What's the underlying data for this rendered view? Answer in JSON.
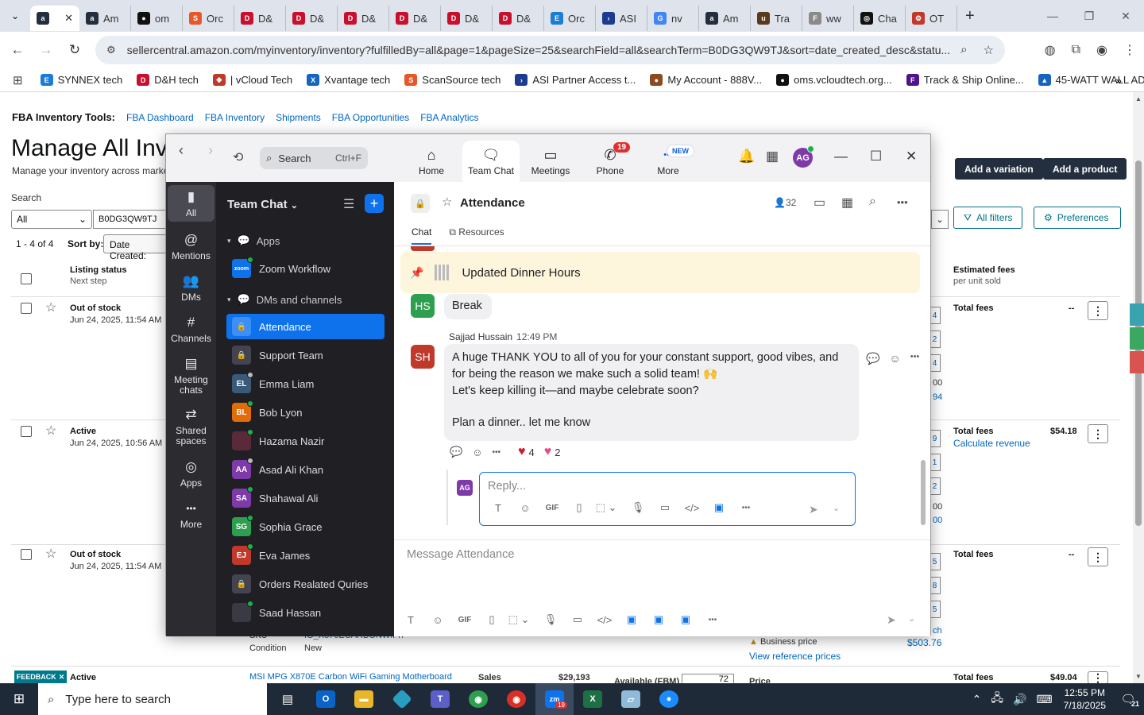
{
  "browser": {
    "tabs": [
      {
        "label": "",
        "favicon": "a",
        "color": "#232f3e",
        "active": true
      },
      {
        "label": "Am",
        "favicon": "a",
        "color": "#232f3e"
      },
      {
        "label": "om",
        "favicon": "●",
        "color": "#111111"
      },
      {
        "label": "Orc",
        "favicon": "S",
        "color": "#e8572a"
      },
      {
        "label": "D&",
        "favicon": "D",
        "color": "#c8102e"
      },
      {
        "label": "D&",
        "favicon": "D",
        "color": "#c8102e"
      },
      {
        "label": "D&",
        "favicon": "D",
        "color": "#c8102e"
      },
      {
        "label": "D&",
        "favicon": "D",
        "color": "#c8102e"
      },
      {
        "label": "D&",
        "favicon": "D",
        "color": "#c8102e"
      },
      {
        "label": "D&",
        "favicon": "D",
        "color": "#c8102e"
      },
      {
        "label": "Orc",
        "favicon": "E",
        "color": "#1a7dd6"
      },
      {
        "label": "ASI",
        "favicon": "›",
        "color": "#1d3c8f"
      },
      {
        "label": "nv",
        "favicon": "G",
        "color": "#4285f4"
      },
      {
        "label": "Am",
        "favicon": "a",
        "color": "#232f3e"
      },
      {
        "label": "Tra",
        "favicon": "u",
        "color": "#5a3a1e"
      },
      {
        "label": "ww",
        "favicon": "F",
        "color": "#8a8a8a"
      },
      {
        "label": "Cha",
        "favicon": "◎",
        "color": "#111111"
      },
      {
        "label": "OT",
        "favicon": "⚙",
        "color": "#c0392b"
      }
    ],
    "url": "sellercentral.amazon.com/myinventory/inventory?fulfilledBy=all&page=1&pageSize=25&searchField=all&searchTerm=B0DG3QW9TJ&sort=date_created_desc&statu...",
    "bookmarks": [
      {
        "label": "SYNNEX tech",
        "color": "#1a7dd6",
        "icon": "E"
      },
      {
        "label": "D&H tech",
        "color": "#c8102e",
        "icon": "D"
      },
      {
        "label": "| vCloud Tech",
        "color": "#c0392b",
        "icon": "◆"
      },
      {
        "label": "Xvantage tech",
        "color": "#1565c0",
        "icon": "X"
      },
      {
        "label": "ScanSource tech",
        "color": "#e8572a",
        "icon": "S"
      },
      {
        "label": "ASI Partner Access t...",
        "color": "#1d3c8f",
        "icon": "›"
      },
      {
        "label": "My Account - 888V...",
        "color": "#8a4b1e",
        "icon": "●"
      },
      {
        "label": "oms.vcloudtech.org...",
        "color": "#111111",
        "icon": "●"
      },
      {
        "label": "Track & Ship Online...",
        "color": "#4d148c",
        "icon": "F"
      },
      {
        "label": "45-WATT WALL AD...",
        "color": "#1565c0",
        "icon": "▲"
      }
    ]
  },
  "amazon": {
    "tools_label": "FBA Inventory Tools:",
    "tools_links": [
      "FBA Dashboard",
      "FBA Inventory",
      "Shipments",
      "FBA Opportunities",
      "FBA Analytics"
    ],
    "title": "Manage All Inv",
    "subtitle": "Manage your inventory across market",
    "add_variation": "Add a variation",
    "add_product": "Add a product",
    "search_label": "Search",
    "search_scope": "All",
    "search_value": "B0DG3QW9TJ",
    "all_filters": "All filters",
    "preferences": "Preferences",
    "count": "1 - 4 of 4",
    "sort_label": "Sort by:",
    "sort_value": "Date Created:",
    "col_listing": "Listing status",
    "col_listing_sub": "Next step",
    "col_fees": "Estimated fees",
    "col_fees_sub": "per unit sold",
    "rows": [
      {
        "status": "Out of stock",
        "date": "Jun 24, 2025, 11:54 AM",
        "fees_label": "Total fees",
        "fee": "--",
        "link": ""
      },
      {
        "status": "Active",
        "date": "Jun 24, 2025, 10:56 AM",
        "fees_label": "Total fees",
        "fee": "$54.18",
        "link": "Calculate revenue"
      },
      {
        "status": "Out of stock",
        "date": "Jun 24, 2025, 11:54 AM",
        "fees_label": "Total fees",
        "fee": "--",
        "link": ""
      },
      {
        "status": "Active",
        "date": "",
        "fees_label": "Total fees",
        "fee": "$49.04",
        "link": ""
      }
    ],
    "sku_label": "SKU",
    "sku_value": "IG_X870ECARBONWIFI7",
    "condition_label": "Condition",
    "condition_value": "New",
    "business_price": "Business price",
    "view_reference": "View reference prices",
    "business_value": "$503.76",
    "product_name": "MSI MPG X870E Carbon WiFi Gaming Motherboard",
    "sales_label": "Sales",
    "sales_value": "$29,193",
    "available_label": "Available (FBM)",
    "available_value": "72",
    "price_label": "Price",
    "feedback": "FEEDBACK"
  },
  "zoom": {
    "search_placeholder": "Search",
    "search_shortcut": "Ctrl+F",
    "tabs": [
      {
        "label": "Home",
        "icon": "⌂"
      },
      {
        "label": "Team Chat",
        "icon": "💬",
        "active": true
      },
      {
        "label": "Meetings",
        "icon": "▭"
      },
      {
        "label": "Phone",
        "icon": "✆",
        "badge": "19"
      },
      {
        "label": "More",
        "icon": "•••",
        "new": "NEW"
      }
    ],
    "avatar": "AG",
    "rail": [
      {
        "label": "All",
        "icon": "💬"
      },
      {
        "label": "Mentions",
        "icon": "@"
      },
      {
        "label": "DMs",
        "icon": "👥"
      },
      {
        "label": "Channels",
        "icon": "#"
      },
      {
        "label": "Meeting chats",
        "icon": "▤"
      },
      {
        "label": "Shared spaces",
        "icon": "⇄"
      },
      {
        "label": "Apps",
        "icon": "◎"
      },
      {
        "label": "More",
        "icon": "•••"
      }
    ],
    "list_title": "Team Chat",
    "section_apps": "Apps",
    "section_dms": "DMs and channels",
    "app_item": "Zoom Workflow",
    "app_logo": "zoom",
    "items": [
      {
        "label": "Attendance",
        "initials": "",
        "color": "#0e72ed",
        "lock": true,
        "active": true
      },
      {
        "label": "Support Team",
        "initials": "",
        "color": "#444450",
        "lock": true
      },
      {
        "label": "Emma Liam",
        "initials": "EL",
        "color": "#3a5a78",
        "status": "off"
      },
      {
        "label": "Bob Lyon",
        "initials": "BL",
        "color": "#e26b0a",
        "status": "on"
      },
      {
        "label": "Hazama Nazir",
        "initials": "",
        "color": "#5a2a3a",
        "status": "on"
      },
      {
        "label": "Asad Ali Khan",
        "initials": "AA",
        "color": "#7e3aa8",
        "status": "off"
      },
      {
        "label": "Shahawal Ali",
        "initials": "SA",
        "color": "#7e3aa8",
        "status": "on"
      },
      {
        "label": "Sophia Grace",
        "initials": "SG",
        "color": "#2e9e4f",
        "status": "on"
      },
      {
        "label": "Eva James",
        "initials": "EJ",
        "color": "#c0392b",
        "status": "on"
      },
      {
        "label": "Orders Realated Quries",
        "initials": "",
        "color": "#444450",
        "lock": true
      },
      {
        "label": "Saad Hassan",
        "initials": "",
        "color": "#3a3a44",
        "status": "on"
      }
    ],
    "channel": {
      "title": "Attendance",
      "members": "32",
      "tab_chat": "Chat",
      "tab_resources": "Resources",
      "pinned": "Updated Dinner Hours",
      "msg1_initials": "HS",
      "msg1_text": "Break",
      "msg2_sender": "Sajjad Hussain",
      "msg2_time": "12:49 PM",
      "msg2_initials": "SH",
      "msg2_line1": "A huge THANK YOU to all of you for your constant support, good vibes, and",
      "msg2_line2": "for being the reason we make such a solid team! 🙌",
      "msg2_line3": "Let's keep killing it—and maybe celebrate soon?",
      "msg2_line4": "Plan a dinner.. let me know",
      "react1_count": "4",
      "react2_count": "2",
      "reply_avatar": "AG",
      "reply_placeholder": "Reply...",
      "compose_placeholder": "Message Attendance"
    }
  },
  "taskbar": {
    "search_placeholder": "Type here to search",
    "time": "12:55 PM",
    "date": "7/18/2025",
    "notif_count": "21",
    "zoom_badge": "19"
  }
}
